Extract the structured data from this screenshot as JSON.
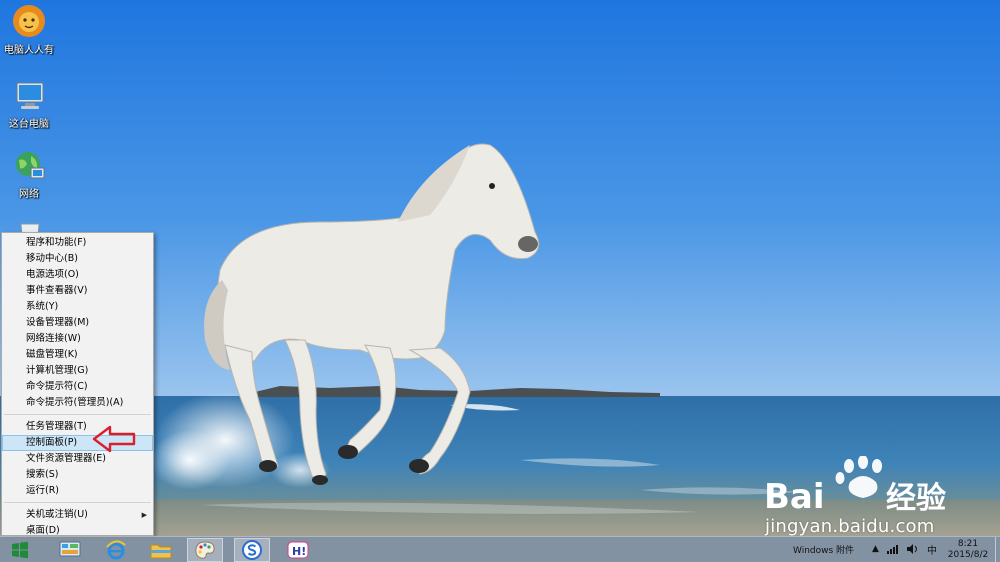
{
  "desktop": {
    "icons": [
      {
        "label": "电脑人人有",
        "icon": "lion-logo-icon"
      },
      {
        "label": "这台电脑",
        "icon": "computer-icon"
      },
      {
        "label": "网络",
        "icon": "network-globe-icon"
      },
      {
        "label": "",
        "icon": "recycle-bin-icon"
      }
    ]
  },
  "context_menu": {
    "group1": [
      "程序和功能(F)",
      "移动中心(B)",
      "电源选项(O)",
      "事件查看器(V)",
      "系统(Y)",
      "设备管理器(M)",
      "网络连接(W)",
      "磁盘管理(K)",
      "计算机管理(G)",
      "命令提示符(C)",
      "命令提示符(管理员)(A)"
    ],
    "group2": [
      "任务管理器(T)",
      "控制面板(P)",
      "文件资源管理器(E)",
      "搜索(S)",
      "运行(R)"
    ],
    "group3": [
      "关机或注销(U)",
      "桌面(D)"
    ],
    "highlighted": "控制面板(P)",
    "annotation_color": "#d9202a"
  },
  "taskbar": {
    "pinned": [
      {
        "name": "start",
        "icon": "windows-logo-icon"
      },
      {
        "name": "control-panel",
        "icon": "control-panel-icon"
      },
      {
        "name": "ie",
        "icon": "internet-explorer-icon"
      },
      {
        "name": "explorer",
        "icon": "file-explorer-icon"
      },
      {
        "name": "paint",
        "icon": "paint-palette-icon"
      },
      {
        "name": "sogou",
        "icon": "sogou-s-icon"
      },
      {
        "name": "app-h",
        "icon": "h-app-icon"
      }
    ],
    "tray": {
      "toolbar_label": "Windows 附件",
      "ime": "中",
      "time": "8:21",
      "date": "2015/8/2"
    }
  },
  "watermark": {
    "brand": "Bai",
    "brand_cn": "经验",
    "url": "jingyan.baidu.com"
  },
  "colors": {
    "sky": "#2d82df",
    "sea": "#3f7fb2",
    "taskbar": "#969696",
    "menu_bg": "#f2f2f2",
    "menu_highlight": "#cde6f7"
  }
}
